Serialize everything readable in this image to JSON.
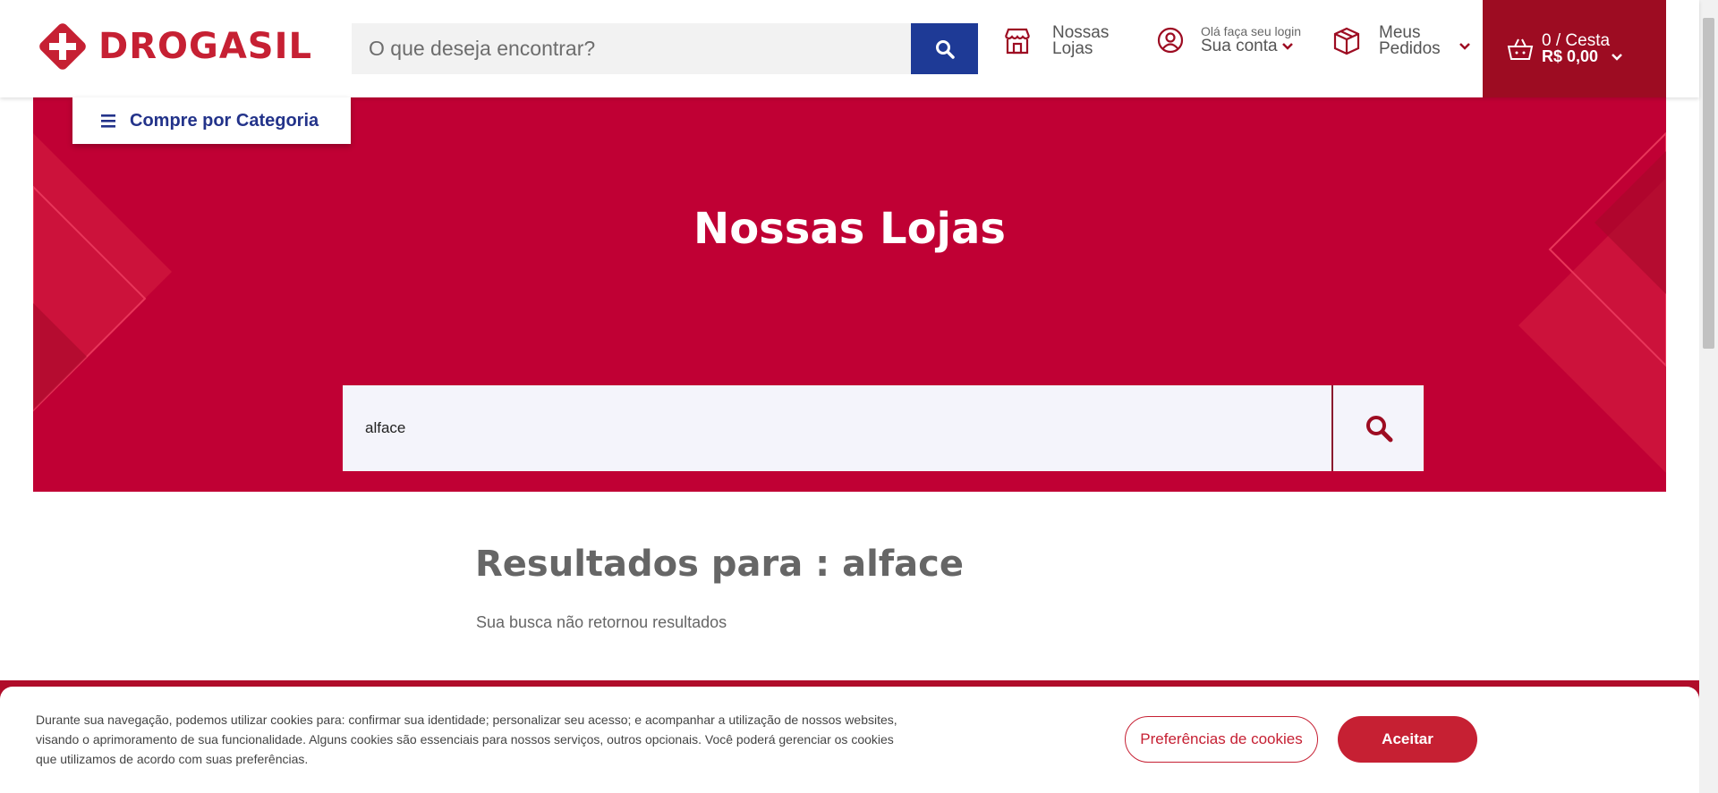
{
  "header": {
    "logo_text": "DROGASIL",
    "search_placeholder": "O que deseja encontrar?",
    "stores": {
      "line1": "Nossas",
      "line2": "Lojas"
    },
    "account": {
      "small": "Olá faça seu login",
      "label": "Sua conta"
    },
    "orders": {
      "line1": "Meus",
      "line2": "Pedidos"
    },
    "cart": {
      "line1": "0 / Cesta",
      "line2": "R$ 0,00"
    }
  },
  "category_button": {
    "label": "Compre por Categoria"
  },
  "hero": {
    "title": "Nossas Lojas",
    "search_value": "alface"
  },
  "results": {
    "title": "Resultados para : alface",
    "message": "Sua busca não retornou resultados"
  },
  "cookies": {
    "text": "Durante sua navegação, podemos utilizar cookies para: confirmar sua identidade; personalizar seu acesso; e acompanhar a utilização de nossos websites, visando o aprimoramento de sua funcionalidade. Alguns cookies são essenciais para nossos serviços, outros opcionais. Você poderá gerenciar os cookies que utilizamos de acordo com suas preferências.",
    "preferences_label": "Preferências de cookies",
    "accept_label": "Aceitar"
  },
  "colors": {
    "brand_red": "#c62033",
    "hero_red": "#c00034",
    "cart_red": "#9d0c22",
    "search_blue": "#1e3a96"
  }
}
